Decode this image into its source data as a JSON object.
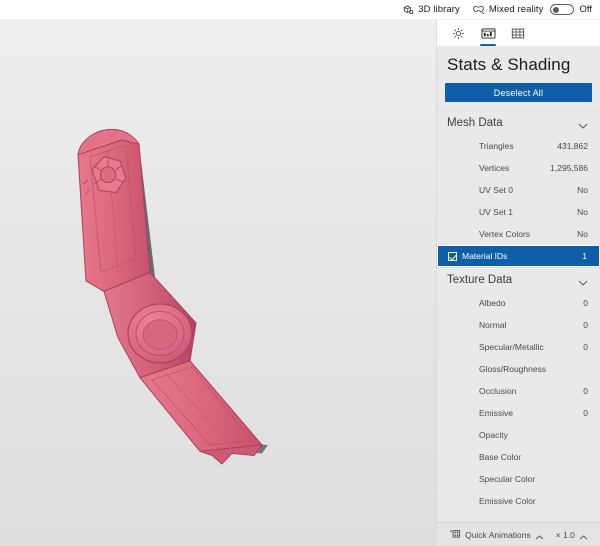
{
  "topbar": {
    "library": {
      "label": "3D library",
      "icon": "cube-library-icon"
    },
    "mixed_reality": {
      "label": "Mixed reality",
      "icon": "mixed-reality-icon"
    },
    "toggle_state": "Off",
    "toggle_on": false
  },
  "panel": {
    "tabs": [
      {
        "name": "lighting",
        "icon": "sun-icon",
        "active": false
      },
      {
        "name": "stats-shading",
        "icon": "stats-image-icon",
        "active": true
      },
      {
        "name": "grid",
        "icon": "grid-icon",
        "active": false
      }
    ],
    "title": "Stats & Shading",
    "deselect_button": "Deselect All",
    "accent_color": "#0f5fa8",
    "sections": [
      {
        "name": "mesh-data",
        "title": "Mesh Data",
        "expanded": true,
        "rows": [
          {
            "label": "Triangles",
            "value": "431,862",
            "selected": false
          },
          {
            "label": "Vertices",
            "value": "1,295,586",
            "selected": false
          },
          {
            "label": "UV Set 0",
            "value": "No",
            "selected": false
          },
          {
            "label": "UV Set 1",
            "value": "No",
            "selected": false
          },
          {
            "label": "Vertex Colors",
            "value": "No",
            "selected": false
          },
          {
            "label": "Material IDs",
            "value": "1",
            "selected": true
          }
        ]
      },
      {
        "name": "texture-data",
        "title": "Texture Data",
        "expanded": true,
        "rows": [
          {
            "label": "Albedo",
            "value": "0",
            "selected": false
          },
          {
            "label": "Normal",
            "value": "0",
            "selected": false
          },
          {
            "label": "Specular/Metallic",
            "value": "0",
            "selected": false
          },
          {
            "label": "Gloss/Roughness",
            "value": "",
            "selected": false
          },
          {
            "label": "Occlusion",
            "value": "0",
            "selected": false
          },
          {
            "label": "Emissive",
            "value": "0",
            "selected": false
          },
          {
            "label": "Opacity",
            "value": "",
            "selected": false
          },
          {
            "label": "Base Color",
            "value": "",
            "selected": false
          },
          {
            "label": "Specular Color",
            "value": "",
            "selected": false
          },
          {
            "label": "Emissive Color",
            "value": "",
            "selected": false
          }
        ]
      }
    ]
  },
  "bottombar": {
    "animations_label": "Quick Animations",
    "animations_icon": "animation-icon",
    "speed_label": "× 1.0"
  },
  "viewport": {
    "model_name": "3d-model-pink-tool",
    "model_color": "#e0687f",
    "model_color_dark": "#9e3551",
    "background_color": "#e6e6e6"
  }
}
